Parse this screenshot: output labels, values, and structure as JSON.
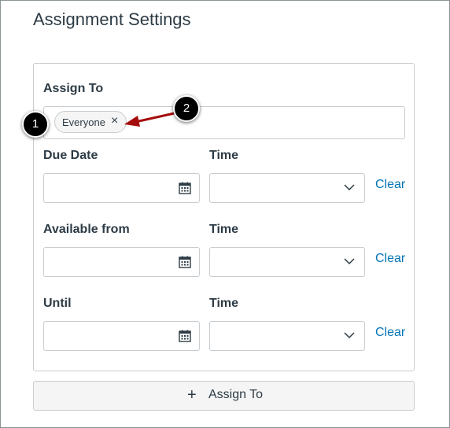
{
  "page": {
    "heading": "Assignment Settings"
  },
  "assign_to": {
    "label": "Assign To",
    "tokens": [
      "Everyone"
    ],
    "remove_symbol": "×"
  },
  "rows": [
    {
      "date_label": "Due Date",
      "time_label": "Time",
      "clear_label": "Clear"
    },
    {
      "date_label": "Available from",
      "time_label": "Time",
      "clear_label": "Clear"
    },
    {
      "date_label": "Until",
      "time_label": "Time",
      "clear_label": "Clear"
    }
  ],
  "add_button": {
    "plus": "+",
    "label": "Assign To"
  },
  "callouts": [
    "1",
    "2"
  ],
  "colors": {
    "link": "#0374b5",
    "text": "#2d3b45",
    "border": "#c7cdd1",
    "annotation_arrow": "#a50d0d"
  },
  "icons": {
    "date_picker": "calendar-icon",
    "time_select": "chevron-down-icon",
    "remove_token": "close-icon",
    "add": "plus-icon"
  }
}
